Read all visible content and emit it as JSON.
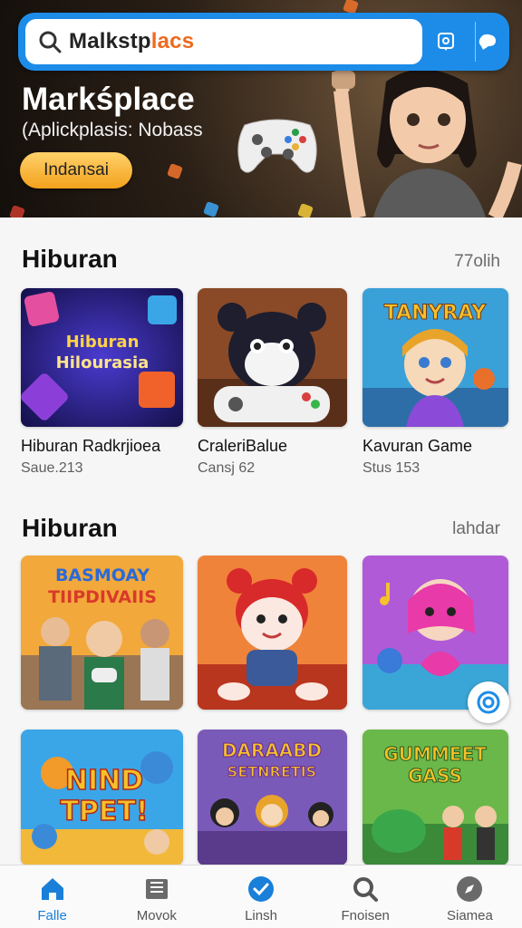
{
  "search": {
    "value_main": "Malkstp",
    "value_accent": "lacs"
  },
  "hero": {
    "title": "Markśplace",
    "subtitle": "(Aplickplasis: Nobass",
    "cta": "Indansai"
  },
  "sections": [
    {
      "title": "Hiburan",
      "link": "77olih",
      "cards": [
        {
          "name": "Hiburan Radkrjioea",
          "meta": "Saue.213",
          "art_lines": [
            "Hiburan",
            "Hilourasia"
          ]
        },
        {
          "name": "CraleriBalue",
          "meta": "Cansj 62",
          "art_lines": []
        },
        {
          "name": "Kavuran Game",
          "meta": "Stus 153",
          "art_lines": [
            "TANYRAY"
          ]
        }
      ]
    },
    {
      "title": "Hiburan",
      "link": "lahdar",
      "cards": [
        {
          "art_lines": [
            "BASMOAY",
            "TIIPDIVAIIS"
          ]
        },
        {
          "art_lines": []
        },
        {
          "art_lines": []
        },
        {
          "art_lines": [
            "NIND",
            "TPET!"
          ]
        },
        {
          "art_lines": [
            "DARAABD",
            "SETNRETIS"
          ]
        },
        {
          "art_lines": [
            "GUMMEET",
            "GASS"
          ]
        }
      ]
    }
  ],
  "nav": [
    {
      "label": "Falle",
      "icon": "home-icon"
    },
    {
      "label": "Movok",
      "icon": "film-icon"
    },
    {
      "label": "Linsh",
      "icon": "check-circle-icon"
    },
    {
      "label": "Fnoisen",
      "icon": "search-icon"
    },
    {
      "label": "Siamea",
      "icon": "compass-icon"
    }
  ],
  "colors": {
    "accent": "#1d8ce8",
    "cta": "#f3a21c",
    "nav_active": "#1a7fd8"
  }
}
